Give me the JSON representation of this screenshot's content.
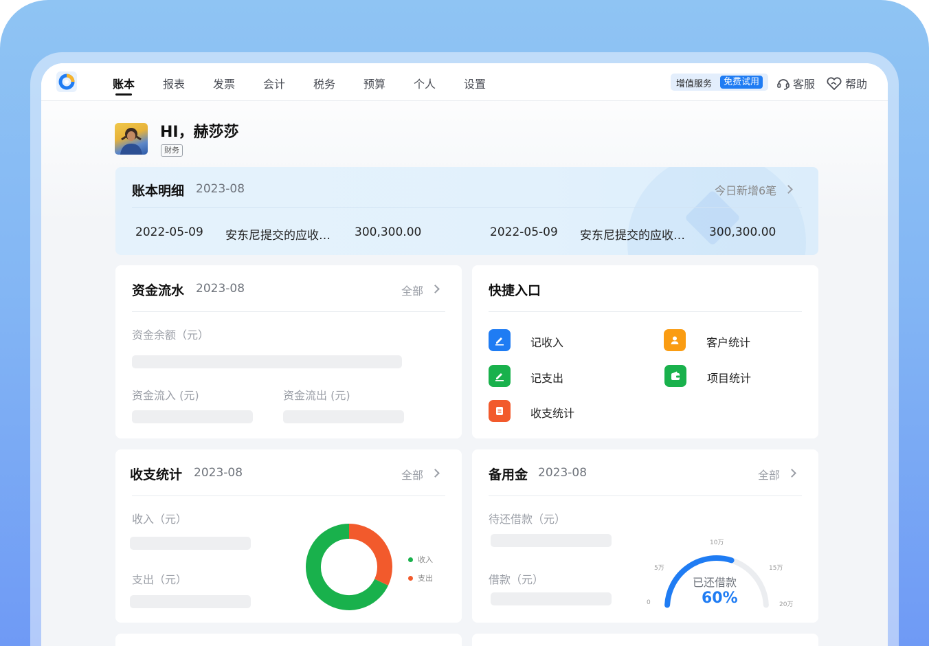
{
  "nav": {
    "tabs": [
      "账本",
      "报表",
      "发票",
      "会计",
      "税务",
      "预算",
      "个人",
      "设置"
    ],
    "active_tab": "账本",
    "value_added_label": "增值服务",
    "free_trial_label": "免费试用",
    "service_label": "客服",
    "help_label": "帮助"
  },
  "user": {
    "greeting": "HI，赫莎莎",
    "role": "财务"
  },
  "ledger": {
    "title": "账本明细",
    "period": "2023-08",
    "today_new": "今日新增6笔",
    "rows": [
      {
        "date": "2022-05-09",
        "desc": "安东尼提交的应收…",
        "amount": "300,300.00"
      },
      {
        "date": "2022-05-09",
        "desc": "安东尼提交的应收…",
        "amount": "300,300.00"
      }
    ]
  },
  "cashflow": {
    "title": "资金流水",
    "period": "2023-08",
    "more": "全部",
    "balance_label": "资金余额（元）",
    "inflow_label": "资金流入 (元)",
    "outflow_label": "资金流出 (元)"
  },
  "quick": {
    "title": "快捷入口",
    "items": [
      {
        "label": "记收入",
        "icon": "pen-icon",
        "color": "#1f7cf3"
      },
      {
        "label": "记支出",
        "icon": "pen-icon",
        "color": "#19b14c"
      },
      {
        "label": "收支统计",
        "icon": "document-icon",
        "color": "#f25a2c"
      },
      {
        "label": "客户统计",
        "icon": "user-icon",
        "color": "#fa9c12"
      },
      {
        "label": "项目统计",
        "icon": "wallet-icon",
        "color": "#19b14c"
      }
    ]
  },
  "income_expense": {
    "title": "收支统计",
    "period": "2023-08",
    "more": "全部",
    "income_label": "收入（元）",
    "expense_label": "支出（元）",
    "chart_data": {
      "type": "pie",
      "donut": true,
      "series": [
        {
          "name": "收入",
          "value": 68,
          "color": "#19b14c"
        },
        {
          "name": "支出",
          "value": 32,
          "color": "#f25a2c"
        }
      ],
      "legend_placement": "right"
    }
  },
  "petty_cash": {
    "title": "备用金",
    "period": "2023-08",
    "more": "全部",
    "pending_label": "待还借款（元）",
    "loan_label": "借款（元）",
    "gauge": {
      "center_label": "已还借款",
      "percent_label": "60%",
      "percent": 60,
      "color": "#1f7cf3",
      "ticks": [
        "0",
        "5万",
        "10万",
        "15万",
        "20万"
      ]
    }
  }
}
